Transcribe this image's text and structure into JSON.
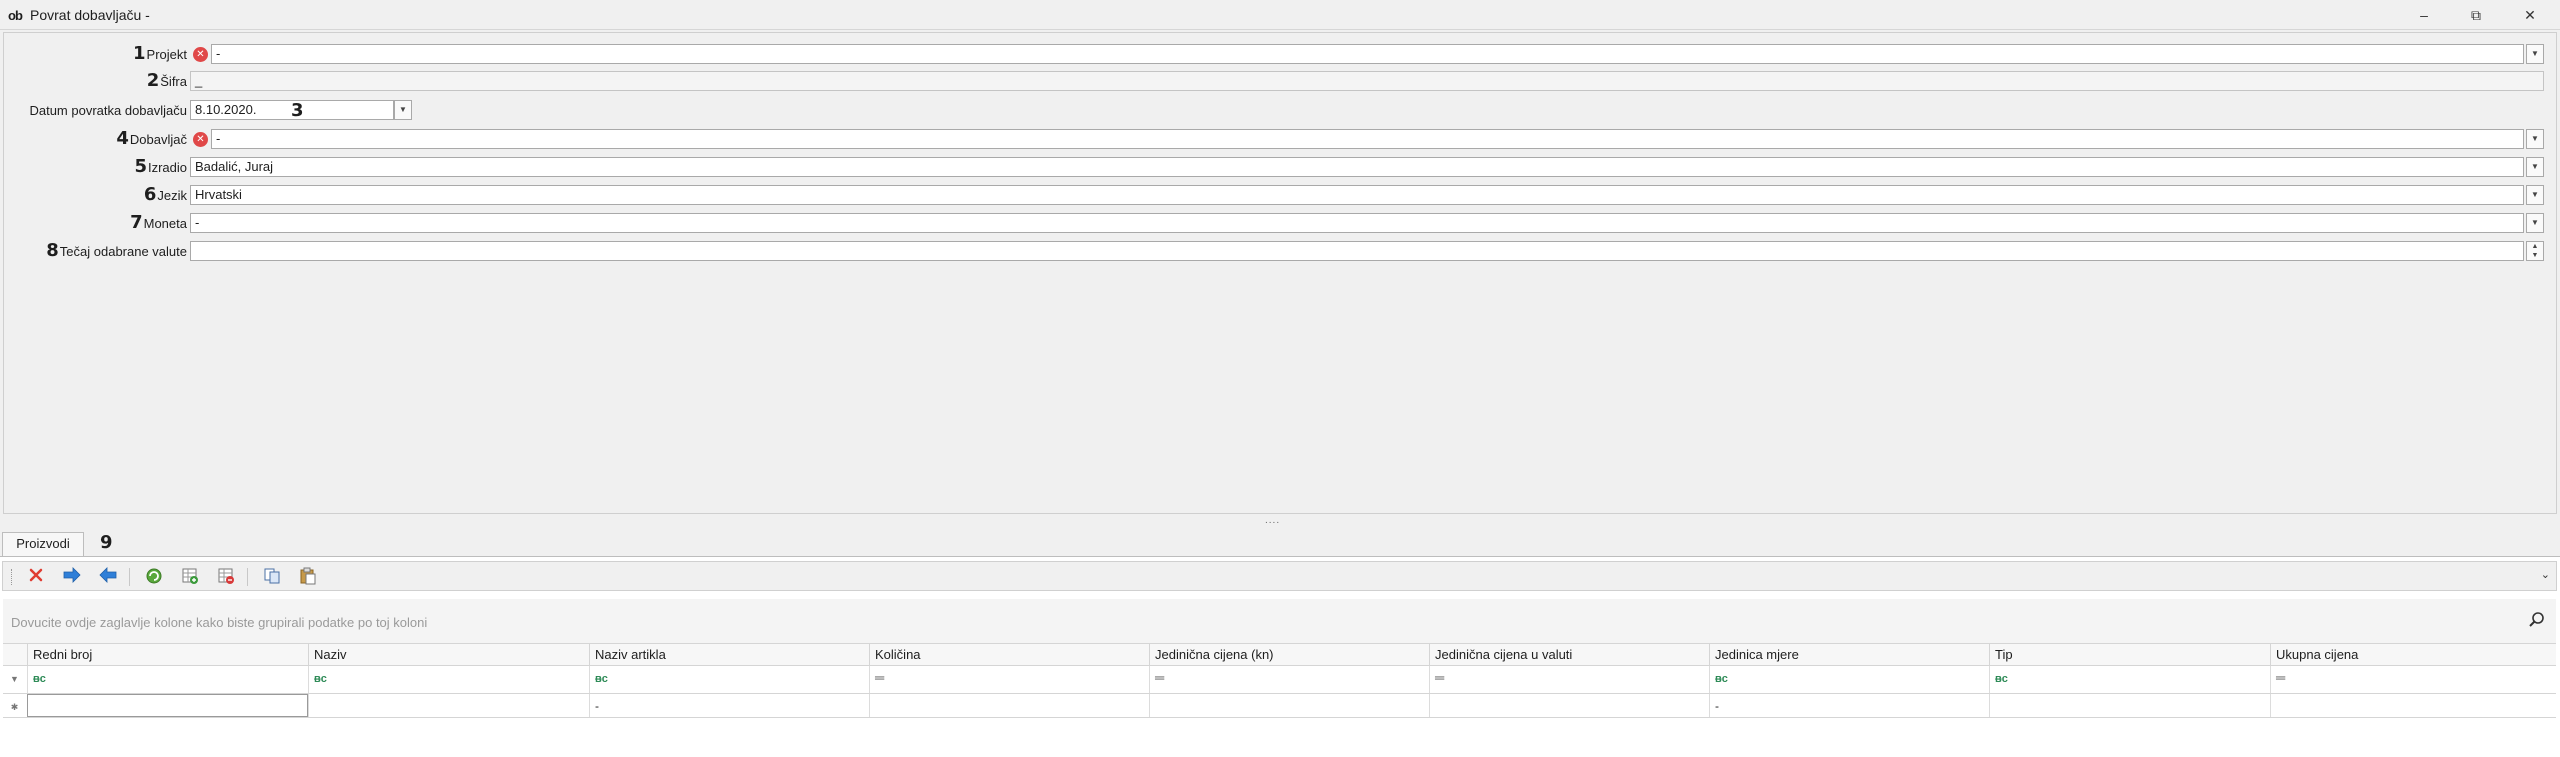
{
  "window": {
    "logo": "ob",
    "title": "Povrat dobavljaču -",
    "min_icon": "minimize-icon",
    "max_icon": "restore-icon",
    "close_icon": "close-icon",
    "min_glyph": "–",
    "max_glyph": "⧉",
    "close_glyph": "✕"
  },
  "form": {
    "projekt": {
      "marker": "1",
      "label": "Projekt",
      "value": "-"
    },
    "sifra": {
      "marker": "2",
      "label": "Šifra",
      "value": "_"
    },
    "datum": {
      "label": "Datum povratka dobavljaču",
      "value": "8.10.2020.",
      "marker": "3"
    },
    "dobavljac": {
      "marker": "4",
      "label": "Dobavljač",
      "value": "-"
    },
    "izradio": {
      "marker": "5",
      "label": "Izradio",
      "value": "Badalić, Juraj"
    },
    "jezik": {
      "marker": "6",
      "label": "Jezik",
      "value": "Hrvatski"
    },
    "moneta": {
      "marker": "7",
      "label": "Moneta",
      "value": "-"
    },
    "tecaj": {
      "marker": "8",
      "label": "Tečaj odabrane valute",
      "value": ""
    },
    "error_glyph": "✕",
    "dropdown_glyph": "▼",
    "spin_up": "▲",
    "spin_down": "▼"
  },
  "splitter": "....",
  "tabs": {
    "proizvodi": "Proizvodi",
    "marker": "9"
  },
  "toolbar": {
    "icons": [
      "delete-icon",
      "move-right-icon",
      "move-left-icon",
      "refresh-icon",
      "add-rows-icon",
      "remove-rows-icon",
      "copy-icon",
      "paste-icon"
    ],
    "chevron": "⌄"
  },
  "grid": {
    "group_hint": "Dovucite ovdje zaglavlje kolone kako biste grupirali podatke po toj koloni",
    "search_glyph": "⌕",
    "columns": [
      "Redni broj",
      "Naziv",
      "Naziv artikla",
      "Količina",
      "Jedinična cijena (kn)",
      "Jedinična cijena u valuti",
      "Jedinica mjere",
      "Tip",
      "Ukupna cijena"
    ],
    "filter_text_glyph": "ᴃc",
    "filter_eq_glyph": "═",
    "filter_row_indicator": "▼",
    "new_row_indicator": "✱",
    "new_row_values": [
      "",
      "",
      "-",
      "",
      "",
      "",
      "-",
      "",
      ""
    ]
  },
  "colors": {
    "error": "#e04848",
    "filter_text_icon": "#2e8b57",
    "delete_icon": "#e03c31",
    "arrow_icon": "#2f7fd8"
  }
}
